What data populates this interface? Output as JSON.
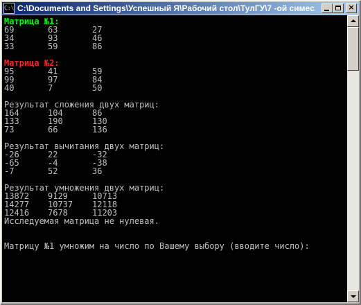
{
  "window": {
    "title": "C:\\Documents and Settings\\Успешный Я\\Рабочий стол\\ТулГУ\\7 -ой симес...",
    "icon_label": "C:\\",
    "buttons": {
      "minimize": "minimize-icon",
      "maximize": "maximize-icon",
      "close": "×"
    }
  },
  "console": {
    "matrix1": {
      "label": "Матрица №1:",
      "rows": [
        [
          "69",
          "63",
          "27"
        ],
        [
          "34",
          "93",
          "46"
        ],
        [
          "33",
          "59",
          "86"
        ]
      ]
    },
    "matrix2": {
      "label": "Матрица №2:",
      "rows": [
        [
          "95",
          "41",
          "59"
        ],
        [
          "99",
          "97",
          "84"
        ],
        [
          "40",
          "7",
          "50"
        ]
      ]
    },
    "sum": {
      "label": "Результат сложения двух матриц:",
      "rows": [
        [
          "164",
          "104",
          "86"
        ],
        [
          "133",
          "190",
          "130"
        ],
        [
          "73",
          "66",
          "136"
        ]
      ]
    },
    "difference": {
      "label": "Результат вычитания двух матриц:",
      "rows": [
        [
          "-26",
          "22",
          "-32"
        ],
        [
          "-65",
          "-4",
          "-38"
        ],
        [
          "-7",
          "52",
          "36"
        ]
      ]
    },
    "product": {
      "label": "Результат умножения двух матриц:",
      "rows": [
        [
          "13872",
          "9129",
          "10713"
        ],
        [
          "14277",
          "10737",
          "12118"
        ],
        [
          "12416",
          "7678",
          "11203"
        ]
      ]
    },
    "status": "Исследуемая матрица не нулевая.",
    "prompt": "Матрицу №1 умножим на число по Вашему выбору (вводите число):"
  },
  "colors": {
    "title_bar_start": "#0a246a",
    "title_bar_end": "#a6caf0",
    "console_bg": "#000000",
    "console_text": "#c0c0c0",
    "matrix1_label": "#00ff00",
    "matrix2_label": "#ff2020"
  }
}
